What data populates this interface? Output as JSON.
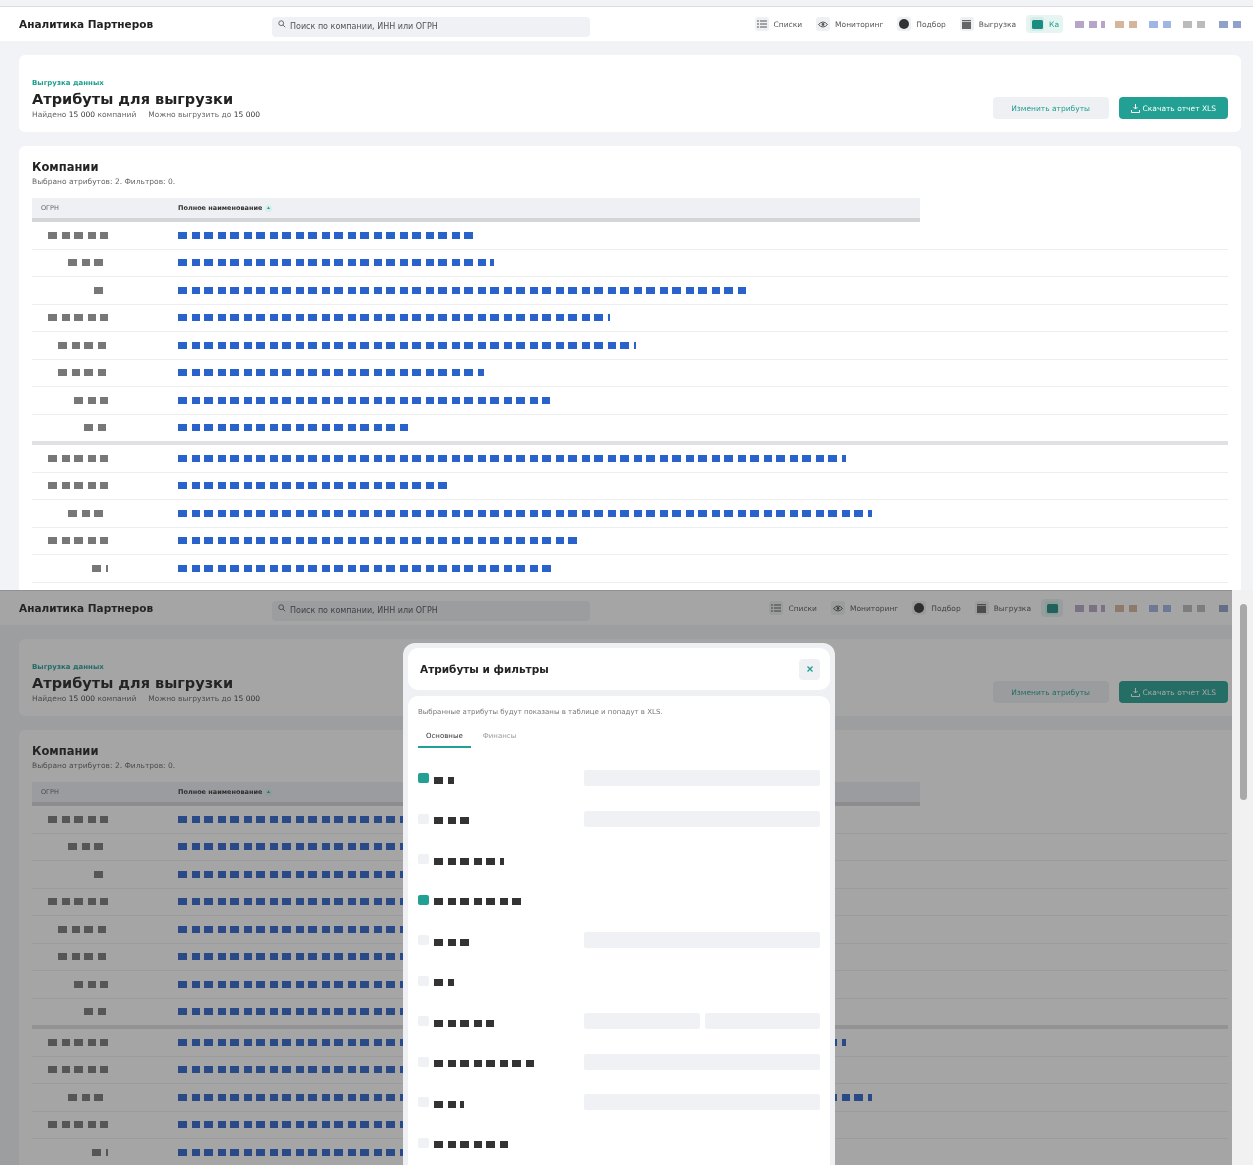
{
  "views": [
    {
      "header": {
        "title": "Аналитика Партнеров",
        "search": {
          "placeholder": "Поиск по компании, ИНН или ОГРН"
        },
        "nav": [
          {
            "label": "Списки",
            "selected": false
          },
          {
            "label": "Мониторинг",
            "selected": false
          },
          {
            "label": "Подбор",
            "selected": false
          },
          {
            "label": "Выгрузка",
            "selected": false
          },
          {
            "label": "Ка",
            "selected": true
          }
        ]
      },
      "page": {
        "breadcrumb": "Выгрузка данных",
        "title": "Атрибуты для выгрузки",
        "found": "Найдено **15 000** компаний",
        "limit": "Можно выгрузить до **15 000**",
        "buttons": [
          {
            "label": "Изменить атрибуты",
            "kind": "secondary"
          },
          {
            "label": "Скачать отчет XLS",
            "kind": "primary"
          }
        ]
      },
      "companies": {
        "title": "Компании",
        "summary": "Выбрано атрибутов: 2. Фильтров: 0.",
        "columns": [
          {
            "label": "ОГРН",
            "sorted": false
          },
          {
            "label": "Полное наименование",
            "sorted": true
          }
        ]
      }
    },
    {
      "header": {
        "title": "Аналитика Партнеров",
        "search": {
          "placeholder": "Поиск по компании, ИНН или ОГРН"
        },
        "nav": [
          {
            "label": "Списки",
            "selected": false
          },
          {
            "label": "Мониторинг",
            "selected": false
          },
          {
            "label": "Подбор",
            "selected": false
          },
          {
            "label": "Выгрузка",
            "selected": false
          },
          {
            "selected": true
          }
        ]
      },
      "page": {
        "breadcrumb": "Выгрузка данных",
        "title": "Атрибуты для выгрузки",
        "found": "Найдено **15 000** компаний",
        "limit": "Можно выгрузить до **15 000**",
        "buttons": [
          {
            "label": "Изменить атрибуты",
            "kind": "secondary"
          },
          {
            "label": "Скачать отчет XLS",
            "kind": "primary"
          }
        ]
      },
      "companies": {
        "title": "Компании",
        "summary": "Выбрано атрибутов: 2. Фильтров: 0.",
        "columns": [
          {
            "label": "ОГРН",
            "sorted": false
          },
          {
            "label": "Полное наименование",
            "sorted": true
          }
        ]
      },
      "modal": {
        "title": "Атрибуты и фильтры",
        "hint": "Выбранные атрибуты будут показаны в таблице и попадут в XLS.",
        "tabs": [
          {
            "label": "Основные",
            "selected": true
          },
          {
            "label": "Финансы",
            "selected": false
          }
        ],
        "attributes": [
          {
            "checked": true,
            "kind": "single"
          },
          {
            "checked": false,
            "kind": "single"
          },
          {
            "checked": false,
            "kind": "plain"
          },
          {
            "checked": true,
            "kind": "plain"
          },
          {
            "checked": false,
            "kind": "single"
          },
          {
            "checked": false,
            "kind": "plain"
          },
          {
            "checked": false,
            "kind": "double"
          },
          {
            "checked": false,
            "kind": "single"
          },
          {
            "checked": false,
            "kind": "single"
          },
          {
            "checked": false,
            "kind": "plain"
          }
        ]
      }
    }
  ]
}
